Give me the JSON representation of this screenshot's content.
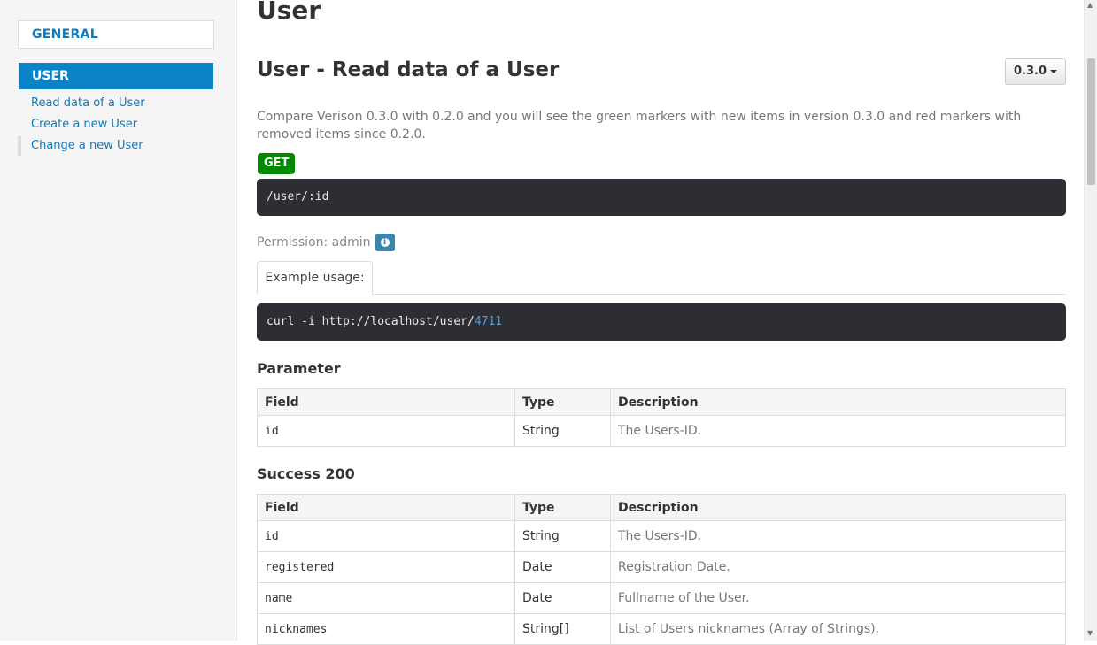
{
  "sidebar": {
    "general_label": "GENERAL",
    "user_label": "USER",
    "items": [
      {
        "label": "Read data of a User"
      },
      {
        "label": "Create a new User"
      },
      {
        "label": "Change a new User"
      }
    ]
  },
  "main": {
    "page_title": "User",
    "section_title": "User - Read data of a User",
    "version_label": "0.3.0",
    "description": "Compare Verison 0.3.0 with 0.2.0 and you will see the green markers with new items in version 0.3.0 and red markers with removed items since 0.2.0.",
    "method": "GET",
    "endpoint": "/user/:id",
    "permission": "Permission: admin",
    "example_tab": "Example usage:",
    "example_code_prefix": "curl -i http://localhost/user/",
    "example_code_id": "4711",
    "parameter_heading": "Parameter",
    "success_heading": "Success 200",
    "table_headers": {
      "field": "Field",
      "type": "Type",
      "description": "Description"
    },
    "parameters": [
      {
        "field": "id",
        "type": "String",
        "description": "The Users-ID."
      }
    ],
    "success": [
      {
        "field": "id",
        "type": "String",
        "description": "The Users-ID."
      },
      {
        "field": "registered",
        "type": "Date",
        "description": "Registration Date."
      },
      {
        "field": "name",
        "type": "Date",
        "description": "Fullname of the User."
      },
      {
        "field": "nicknames",
        "type": "String[]",
        "description": "List of Users nicknames (Array of Strings)."
      }
    ]
  },
  "colors": {
    "accent": "#0b83c7",
    "method_get": "#008a00",
    "code_bg": "#2d2e34",
    "info": "#3a87ad"
  }
}
